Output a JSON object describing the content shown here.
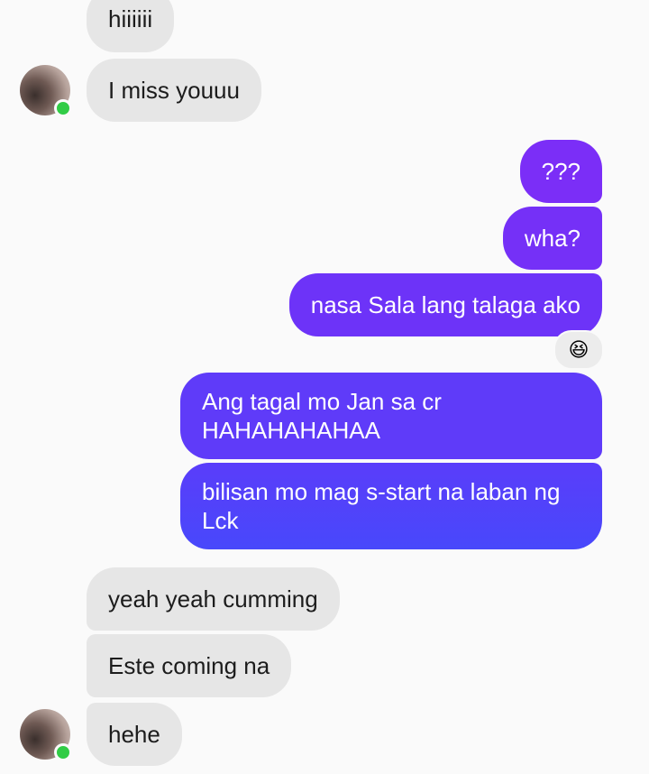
{
  "messages": [
    {
      "id": "m1",
      "side": "in",
      "text": "hiiiiii"
    },
    {
      "id": "m2",
      "side": "in",
      "text": "I miss youuu"
    },
    {
      "id": "m3",
      "side": "out",
      "text": "???"
    },
    {
      "id": "m4",
      "side": "out",
      "text": "wha?"
    },
    {
      "id": "m5",
      "side": "out",
      "text": "nasa Sala lang talaga ako",
      "reaction": "😆"
    },
    {
      "id": "m6",
      "side": "out",
      "text": "Ang tagal mo Jan sa cr\nHAHAHAHAHAA"
    },
    {
      "id": "m7",
      "side": "out",
      "text": "bilisan mo mag s-start na laban ng\nLck"
    },
    {
      "id": "m8",
      "side": "in",
      "text": "yeah yeah cumming"
    },
    {
      "id": "m9",
      "side": "in",
      "text": "Este coming na"
    },
    {
      "id": "m10",
      "side": "in",
      "text": "hehe"
    }
  ],
  "colors": {
    "incoming_bg": "#e6e6e6",
    "outgoing_gradient_top": "#8a2cf6",
    "outgoing_gradient_bottom": "#4848fb",
    "online_dot": "#31cc46"
  },
  "avatar": {
    "icon": "contact-avatar",
    "status_icon": "online-dot-icon"
  }
}
